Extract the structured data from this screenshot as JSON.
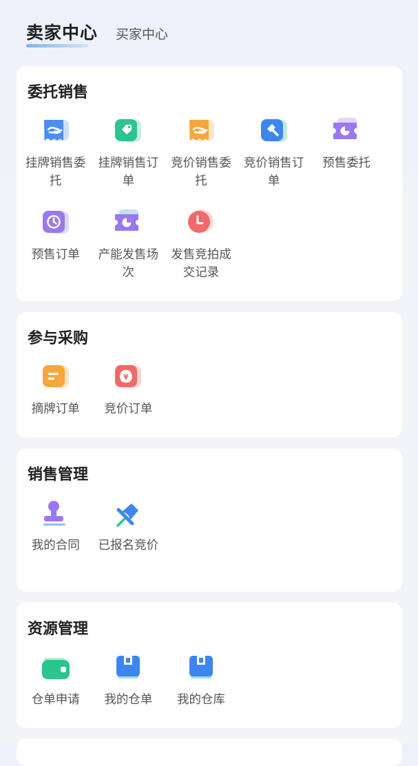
{
  "header": {
    "active_tab": "卖家中心",
    "secondary_tab": "买家中心"
  },
  "sections": [
    {
      "title": "委托销售",
      "items": [
        {
          "label": "挂牌销售委托",
          "icon": "hand-receipt-icon",
          "color": "#4a8ff0"
        },
        {
          "label": "挂牌销售订单",
          "icon": "tag-icon",
          "color": "#2cc48f"
        },
        {
          "label": "竞价销售委托",
          "icon": "hand-receipt-icon",
          "color": "#f5a73b"
        },
        {
          "label": "竞价销售订单",
          "icon": "gavel-icon",
          "color": "#3d86ee"
        },
        {
          "label": "预售委托",
          "icon": "ticket-pie-icon",
          "color": "#9a78ef"
        },
        {
          "label": "预售订单",
          "icon": "clock-icon",
          "color": "#9a78ef"
        },
        {
          "label": "产能发售场次",
          "icon": "ticket-pie-icon",
          "color": "#9a78ef"
        },
        {
          "label": "发售竞拍成交记录",
          "icon": "clock-circle-icon",
          "color": "#f06a6a"
        }
      ]
    },
    {
      "title": "参与采购",
      "items": [
        {
          "label": "摘牌订单",
          "icon": "document-lines-icon",
          "color": "#f5a73b"
        },
        {
          "label": "竞价订单",
          "icon": "yuan-bag-icon",
          "color": "#f06a6a"
        }
      ]
    },
    {
      "title": "销售管理",
      "items": [
        {
          "label": "我的合同",
          "icon": "stamp-icon",
          "color": "#9a78ef"
        },
        {
          "label": "已报名竞价",
          "icon": "pin-icon",
          "color": "#3d86ee"
        }
      ]
    },
    {
      "title": "资源管理",
      "items": [
        {
          "label": "仓单申请",
          "icon": "wallet-icon",
          "color": "#2cc48f"
        },
        {
          "label": "我的仓单",
          "icon": "box-icon",
          "color": "#3d86ee"
        },
        {
          "label": "我的仓库",
          "icon": "box-icon",
          "color": "#3d86ee"
        }
      ]
    }
  ]
}
